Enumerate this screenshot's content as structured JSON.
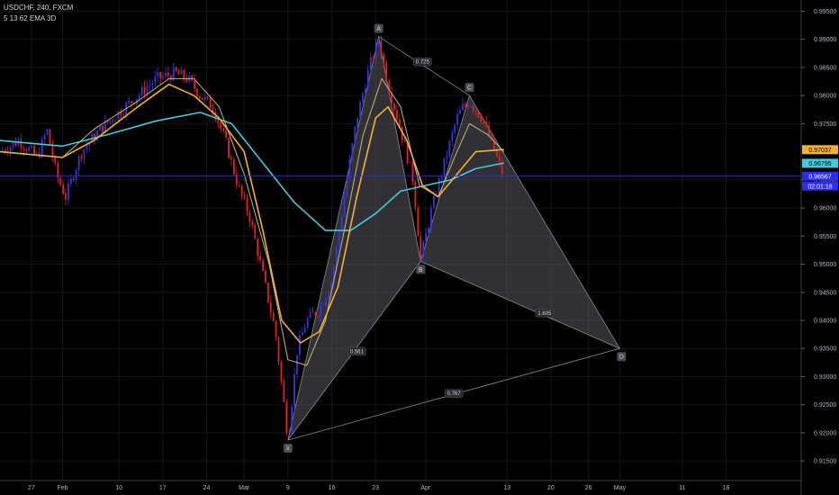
{
  "header": {
    "symbol": "USDCHF, 240, FXCM",
    "indicator": "5 13 62 EMA 3D"
  },
  "colors": {
    "background": "#000000",
    "bull_candle": "#3a35d8",
    "bear_candle": "#e0202a",
    "ema_fast": "#c8b870",
    "ema_mid": "#f5b03a",
    "ema_slow": "#48c8dc",
    "pattern_fill": "#5a5a60",
    "current_price_line": "#2d2df0"
  },
  "chart_data": {
    "type": "candlestick",
    "ylim": [
      0.9115,
      0.997
    ],
    "y_ticks": [
      "0.99500",
      "0.99000",
      "0.98500",
      "0.98000",
      "0.97500",
      "0.96500",
      "0.96000",
      "0.95500",
      "0.95000",
      "0.94500",
      "0.94000",
      "0.93500",
      "0.93000",
      "0.92500",
      "0.92000",
      "0.91500"
    ],
    "x_ticks": [
      "27",
      "Feb",
      "10",
      "17",
      "24",
      "Mar",
      "9",
      "16",
      "23",
      "Apr",
      "13",
      "20",
      "26",
      "May",
      "11",
      "18"
    ],
    "x_tick_days": [
      0,
      5,
      14,
      21,
      28,
      34,
      41,
      48,
      55,
      63,
      76,
      83,
      89,
      94,
      104,
      111
    ],
    "x_range_days": [
      -5,
      123
    ],
    "data_end_day": 75.5,
    "current_price": 0.96567,
    "price_badges": [
      {
        "label": "0.97037",
        "value": 0.97037,
        "series": "ema_mid"
      },
      {
        "label": "0.96795",
        "value": 0.96795,
        "series": "ema_slow"
      },
      {
        "label": "0.96567",
        "value": 0.96567,
        "series": "current_price"
      },
      {
        "label": "02:01:18",
        "value": 0.964,
        "series": "countdown"
      }
    ],
    "close_path": [
      [
        -5,
        0.97
      ],
      [
        -2,
        0.972
      ],
      [
        1,
        0.969
      ],
      [
        2.5,
        0.974
      ],
      [
        4,
        0.966
      ],
      [
        5.5,
        0.962
      ],
      [
        8,
        0.97
      ],
      [
        11,
        0.974
      ],
      [
        14,
        0.977
      ],
      [
        17,
        0.98
      ],
      [
        20,
        0.983
      ],
      [
        23,
        0.984
      ],
      [
        25,
        0.983
      ],
      [
        27,
        0.98
      ],
      [
        29,
        0.978
      ],
      [
        31,
        0.972
      ],
      [
        33,
        0.964
      ],
      [
        35,
        0.958
      ],
      [
        37,
        0.948
      ],
      [
        39,
        0.938
      ],
      [
        41,
        0.919
      ],
      [
        42.5,
        0.935
      ],
      [
        44,
        0.94
      ],
      [
        46,
        0.942
      ],
      [
        48,
        0.947
      ],
      [
        50,
        0.962
      ],
      [
        52,
        0.976
      ],
      [
        54,
        0.985
      ],
      [
        55.5,
        0.99
      ],
      [
        57,
        0.982
      ],
      [
        59,
        0.974
      ],
      [
        61,
        0.965
      ],
      [
        62.2,
        0.951
      ],
      [
        64,
        0.96
      ],
      [
        66,
        0.968
      ],
      [
        68,
        0.976
      ],
      [
        69,
        0.978
      ],
      [
        70,
        0.979
      ],
      [
        72,
        0.976
      ],
      [
        74,
        0.97
      ],
      [
        75.5,
        0.9655
      ]
    ],
    "ema_fast": [
      [
        -5,
        0.97
      ],
      [
        5,
        0.969
      ],
      [
        10,
        0.974
      ],
      [
        17,
        0.979
      ],
      [
        22,
        0.983
      ],
      [
        26,
        0.983
      ],
      [
        30,
        0.978
      ],
      [
        34,
        0.966
      ],
      [
        38,
        0.95
      ],
      [
        41,
        0.933
      ],
      [
        44,
        0.932
      ],
      [
        47,
        0.94
      ],
      [
        50,
        0.956
      ],
      [
        53,
        0.973
      ],
      [
        56,
        0.983
      ],
      [
        59,
        0.978
      ],
      [
        62,
        0.964
      ],
      [
        65,
        0.962
      ],
      [
        68,
        0.97
      ],
      [
        70,
        0.975
      ],
      [
        73,
        0.973
      ],
      [
        75.5,
        0.97
      ]
    ],
    "ema_mid": [
      [
        -5,
        0.97
      ],
      [
        5,
        0.969
      ],
      [
        10,
        0.972
      ],
      [
        17,
        0.978
      ],
      [
        22,
        0.982
      ],
      [
        26,
        0.98
      ],
      [
        30,
        0.976
      ],
      [
        34,
        0.97
      ],
      [
        37,
        0.956
      ],
      [
        40,
        0.94
      ],
      [
        43,
        0.936
      ],
      [
        46,
        0.938
      ],
      [
        49,
        0.946
      ],
      [
        52,
        0.962
      ],
      [
        55,
        0.976
      ],
      [
        57,
        0.978
      ],
      [
        60,
        0.972
      ],
      [
        62.5,
        0.964
      ],
      [
        65,
        0.962
      ],
      [
        68,
        0.966
      ],
      [
        71,
        0.97
      ],
      [
        75.5,
        0.9704
      ]
    ],
    "ema_slow": [
      [
        -5,
        0.972
      ],
      [
        5,
        0.971
      ],
      [
        12,
        0.973
      ],
      [
        20,
        0.9755
      ],
      [
        27,
        0.977
      ],
      [
        32,
        0.975
      ],
      [
        37,
        0.968
      ],
      [
        42,
        0.961
      ],
      [
        47,
        0.956
      ],
      [
        51,
        0.956
      ],
      [
        55,
        0.959
      ],
      [
        59,
        0.963
      ],
      [
        63,
        0.964
      ],
      [
        67,
        0.965
      ],
      [
        71,
        0.967
      ],
      [
        75.5,
        0.968
      ]
    ],
    "pattern": {
      "points": [
        {
          "label": "X",
          "day": 41,
          "price": 0.9187
        },
        {
          "label": "A",
          "day": 55.5,
          "price": 0.9905
        },
        {
          "label": "B",
          "day": 62.2,
          "price": 0.9505
        },
        {
          "label": "C",
          "day": 70.0,
          "price": 0.98
        },
        {
          "label": "D",
          "day": 94,
          "price": 0.935
        }
      ],
      "ratios": [
        {
          "label": "0.725",
          "day": 62.5,
          "price": 0.986
        },
        {
          "label": "1.605",
          "day": 82,
          "price": 0.9413
        },
        {
          "label": "0.561",
          "day": 52,
          "price": 0.9345
        },
        {
          "label": "0.767",
          "day": 67.5,
          "price": 0.927
        }
      ]
    }
  }
}
